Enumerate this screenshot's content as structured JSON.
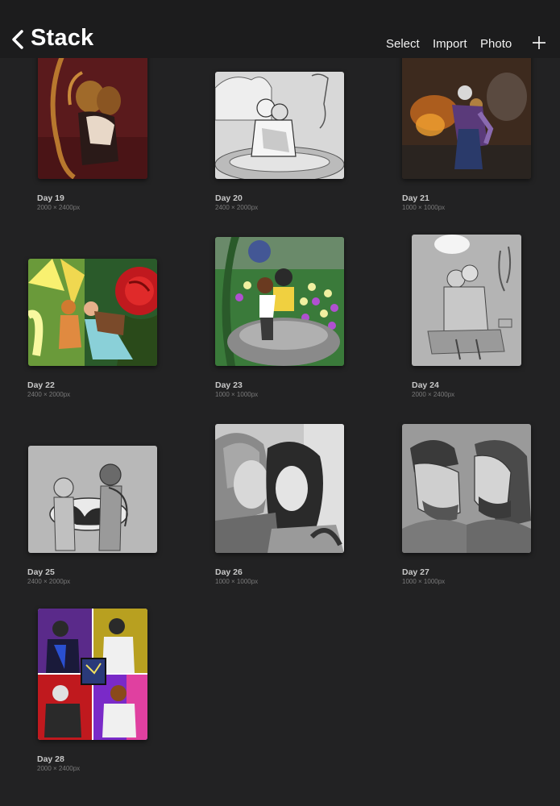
{
  "header": {
    "title": "Stack",
    "select_label": "Select",
    "import_label": "Import",
    "photo_label": "Photo",
    "back_icon": "chevron-left-icon",
    "add_icon": "plus-icon"
  },
  "artworks": [
    {
      "name": "Day 19",
      "dims": "2000 × 2400px"
    },
    {
      "name": "Day 20",
      "dims": "2400 × 2000px"
    },
    {
      "name": "Day 21",
      "dims": "1000 × 1000px"
    },
    {
      "name": "Day 22",
      "dims": "2400 × 2000px"
    },
    {
      "name": "Day 23",
      "dims": "1000 × 1000px"
    },
    {
      "name": "Day 24",
      "dims": "2000 × 2400px"
    },
    {
      "name": "Day 25",
      "dims": "2400 × 2000px"
    },
    {
      "name": "Day 26",
      "dims": "1000 × 1000px"
    },
    {
      "name": "Day 27",
      "dims": "1000 × 1000px"
    },
    {
      "name": "Day 28",
      "dims": "2000 × 2400px"
    }
  ],
  "colors": {
    "background": "#222223",
    "header_background": "#1c1c1d",
    "text_primary": "#ffffff",
    "text_secondary": "#c8c8c8",
    "text_muted": "#7a7a7a"
  }
}
